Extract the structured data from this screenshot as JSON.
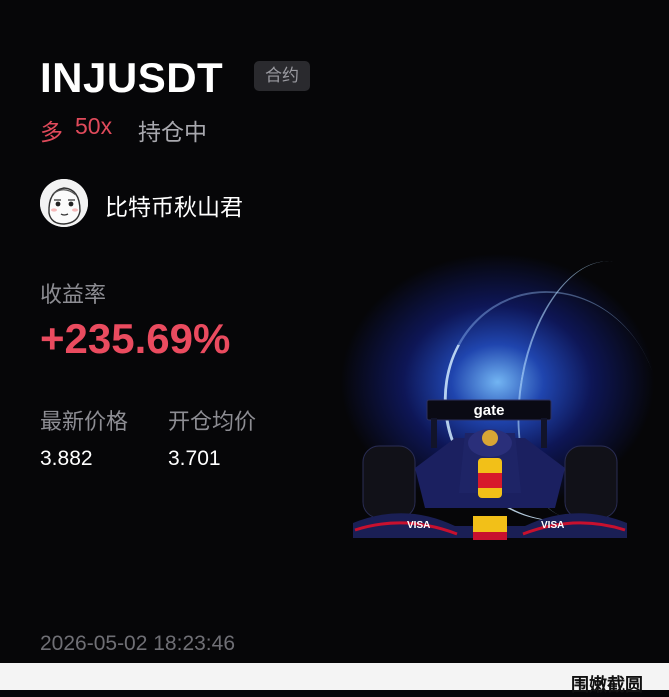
{
  "header": {
    "symbol": "INJUSDT",
    "tag": "合约",
    "side": "多",
    "leverage": "50x",
    "status": "持仓中"
  },
  "user": {
    "name": "比特币秋山君"
  },
  "stats": {
    "roi_label": "收益率",
    "roi_value": "+235.69%",
    "last_price_label": "最新价格",
    "last_price": "3.882",
    "entry_price_label": "开仓均价",
    "entry_price": "3.701"
  },
  "timestamp": "2026-05-02 18:23:46",
  "promo": {
    "brand": "gate",
    "car_livery": "VISA"
  },
  "footer": {
    "text": "围嫩截圆"
  },
  "colors": {
    "accent_red": "#ea4b5f",
    "background": "#060608",
    "muted": "#8d8d93"
  }
}
